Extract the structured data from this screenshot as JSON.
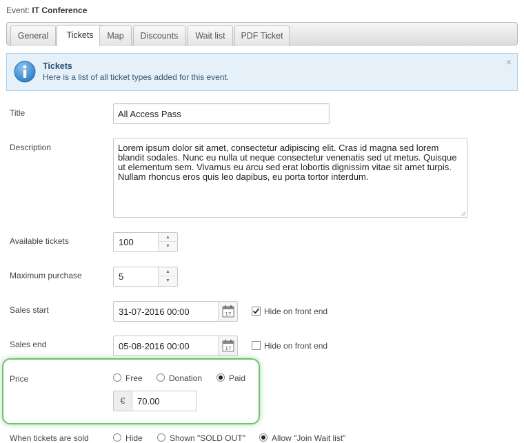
{
  "event": {
    "prefix": "Event:",
    "name": "IT Conference"
  },
  "tabs": [
    "General",
    "Tickets",
    "Map",
    "Discounts",
    "Wait list",
    "PDF Ticket"
  ],
  "active_tab": "Tickets",
  "alert": {
    "title": "Tickets",
    "text": "Here is a list of all ticket types added for this event.",
    "close": "×"
  },
  "form": {
    "title_label": "Title",
    "title_value": "All Access Pass",
    "description_label": "Description",
    "description_value": "Lorem ipsum dolor sit amet, consectetur adipiscing elit. Cras id magna sed lorem blandit sodales. Nunc eu nulla ut neque consectetur venenatis sed ut metus. Quisque ut elementum sem. Vivamus eu arcu sed erat lobortis dignissim vitae sit amet turpis. Nullam rhoncus eros quis leo dapibus, eu porta tortor interdum.",
    "available_label": "Available tickets",
    "available_value": "100",
    "max_label": "Maximum purchase",
    "max_value": "5",
    "sales_start_label": "Sales start",
    "sales_start_value": "31-07-2016 00:00",
    "sales_start_hide_label": "Hide on front end",
    "sales_start_hide_checked": true,
    "sales_end_label": "Sales end",
    "sales_end_value": "05-08-2016 00:00",
    "sales_end_hide_label": "Hide on front end",
    "sales_end_hide_checked": false,
    "price_label": "Price",
    "price_options": [
      "Free",
      "Donation",
      "Paid"
    ],
    "price_selected": "Paid",
    "currency_symbol": "€",
    "price_value": "70.00",
    "sold_label": "When tickets are sold",
    "sold_options": [
      "Hide",
      "Shown \"SOLD OUT\"",
      "Allow \"Join Wait list\""
    ],
    "sold_selected": "Allow \"Join Wait list\""
  },
  "colors": {
    "highlight": "#6cc36c",
    "alert_bg": "#e5f0f9",
    "info_icon": "#3f8fd3"
  }
}
